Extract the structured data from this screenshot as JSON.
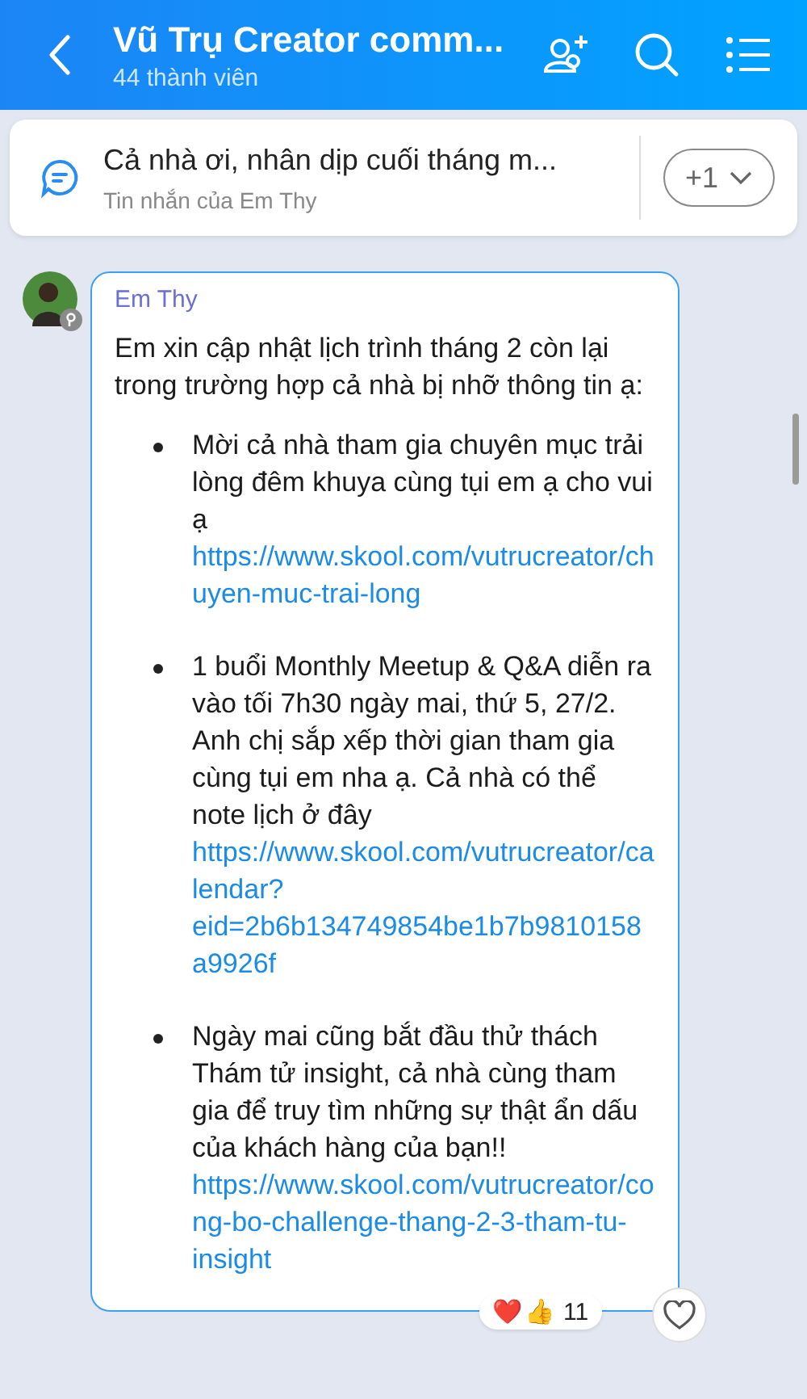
{
  "header": {
    "title": "Vũ Trụ Creator comm...",
    "subtitle": "44 thành viên"
  },
  "pinned": {
    "text": "Cả nhà ơi, nhân dịp cuối tháng m...",
    "caption": "Tin nhắn của Em Thy",
    "count_button": "+1"
  },
  "message": {
    "sender": "Em Thy",
    "intro": "Em xin cập nhật lịch trình tháng 2 còn lại trong trường hợp cả nhà bị nhỡ thông tin ạ:",
    "items": [
      {
        "text": "Mời cả nhà tham gia chuyên mục trải lòng đêm khuya cùng tụi em ạ cho vui ạ ",
        "link": "https://www.skool.com/vutrucreator/chuyen-muc-trai-long"
      },
      {
        "text": "1 buổi Monthly Meetup & Q&A diễn ra vào tối 7h30 ngày mai, thứ 5, 27/2. Anh chị sắp xếp thời gian tham gia cùng tụi em nha ạ. Cả nhà có thể note lịch ở đây ",
        "link": "https://www.skool.com/vutrucreator/calendar?eid=2b6b134749854be1b7b9810158a9926f"
      },
      {
        "text": "Ngày mai cũng bắt đầu thử thách Thám tử insight, cả nhà cùng tham gia để truy tìm những sự thật ẩn dấu của khách hàng của bạn!! ",
        "link": "https://www.skool.com/vutrucreator/cong-bo-challenge-thang-2-3-tham-tu-insight"
      }
    ],
    "reactions": {
      "emojis": [
        "❤️",
        "👍"
      ],
      "count": "11"
    }
  }
}
